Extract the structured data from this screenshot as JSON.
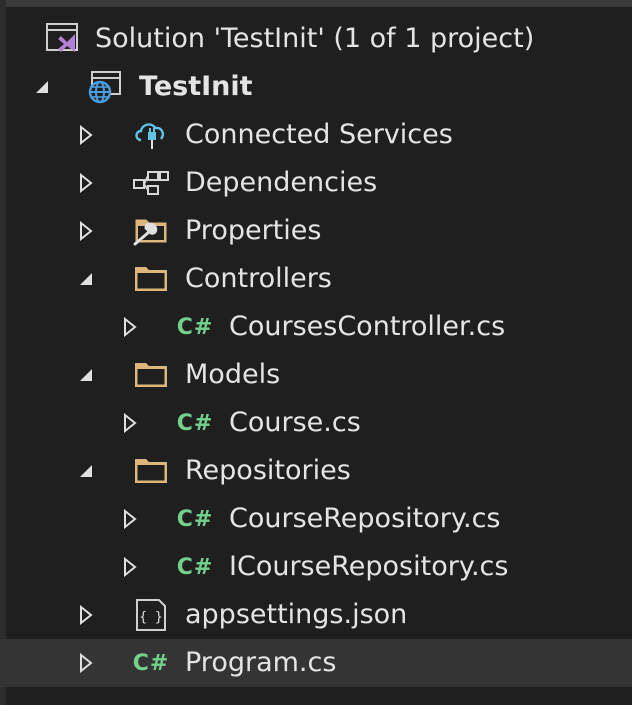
{
  "solution": {
    "label": "Solution 'TestInit' (1 of 1 project)"
  },
  "project": {
    "label": "TestInit"
  },
  "items": {
    "connected_services": "Connected Services",
    "dependencies": "Dependencies",
    "properties": "Properties",
    "controllers": "Controllers",
    "courses_controller": "CoursesController.cs",
    "models": "Models",
    "course": "Course.cs",
    "repositories": "Repositories",
    "course_repository": "CourseRepository.cs",
    "icourse_repository": "ICourseRepository.cs",
    "appsettings": "appsettings.json",
    "program": "Program.cs"
  },
  "icons": {
    "solution": "visual-studio-solution-icon",
    "project": "web-project-globe-icon",
    "connected_services": "cloud-plug-icon",
    "dependencies": "dependency-nodes-icon",
    "properties": "folder-wrench-icon",
    "folder": "folder-icon",
    "csharp": "csharp-file-icon",
    "json": "json-file-icon"
  },
  "csharp_glyph": "C#",
  "json_glyph": "{ }",
  "colors": {
    "background": "#1f1f1f",
    "selected_row": "#343434",
    "text": "#e4e4e4",
    "csharp_green": "#73d18c",
    "folder_tan": "#dcb67a",
    "vs_purple": "#b180d7",
    "globe_blue": "#4a9fe0"
  }
}
